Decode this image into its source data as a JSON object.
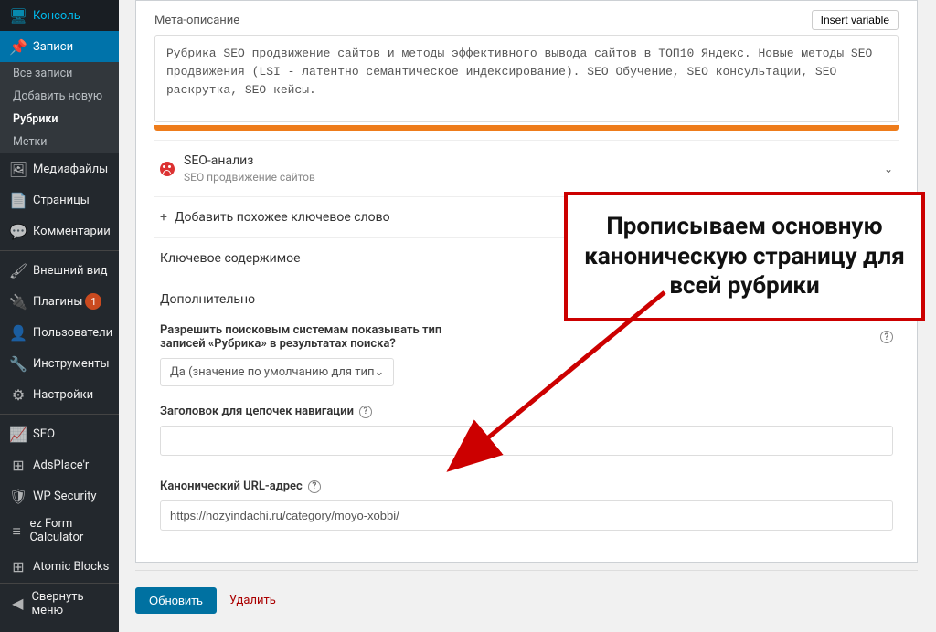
{
  "sidebar": {
    "items": [
      {
        "icon": "🖥",
        "label": "Консоль"
      },
      {
        "icon": "📌",
        "label": "Записи"
      },
      {
        "icon": "🖼",
        "label": "Медиафайлы"
      },
      {
        "icon": "📄",
        "label": "Страницы"
      },
      {
        "icon": "💬",
        "label": "Комментарии"
      },
      {
        "icon": "🖌",
        "label": "Внешний вид"
      },
      {
        "icon": "🔌",
        "label": "Плагины",
        "badge": "1"
      },
      {
        "icon": "👤",
        "label": "Пользователи"
      },
      {
        "icon": "🔧",
        "label": "Инструменты"
      },
      {
        "icon": "⚙",
        "label": "Настройки"
      },
      {
        "icon": "📈",
        "label": "SEO"
      },
      {
        "icon": "⊞",
        "label": "AdsPlace'r"
      },
      {
        "icon": "🛡",
        "label": "WP Security"
      },
      {
        "icon": "≡",
        "label": "ez Form Calculator"
      },
      {
        "icon": "⊞",
        "label": "Atomic Blocks"
      }
    ],
    "submenu": [
      {
        "label": "Все записи"
      },
      {
        "label": "Добавить новую"
      },
      {
        "label": "Рубрики"
      },
      {
        "label": "Метки"
      }
    ],
    "collapse": "Свернуть меню"
  },
  "meta": {
    "label": "Мета-описание",
    "insert_var": "Insert variable",
    "value": "Рубрика SEO продвижение сайтов и методы эффективного вывода сайтов в ТОП10 Яндекс. Новые методы SEO продвижения (LSI - латентно семантическое индексирование). SEO Обучение, SEO консультации, SEO раскрутка, SEO кейсы."
  },
  "accordion": {
    "seo_analysis": {
      "title": "SEO-анализ",
      "sub": "SEO продвижение сайтов"
    },
    "add_keyword": {
      "icon": "+",
      "title": "Добавить похожее ключевое слово"
    },
    "key_content": {
      "title": "Ключевое содержимое"
    },
    "additional": {
      "title": "Дополнительно"
    }
  },
  "advanced": {
    "allow_label": "Разрешить поисковым системам показывать тип записей «Рубрика» в результатах поиска?",
    "allow_select": "Да (значение по умолчанию для тип",
    "breadcrumb_label": "Заголовок для цепочек навигации",
    "breadcrumb_value": "",
    "canonical_label": "Канонический URL-адрес",
    "canonical_value": "https://hozyindachi.ru/category/moyo-xobbi/"
  },
  "footer": {
    "update": "Обновить",
    "delete": "Удалить"
  },
  "callout": {
    "text": "Прописываем основную каноническую страницу для всей рубрики"
  }
}
